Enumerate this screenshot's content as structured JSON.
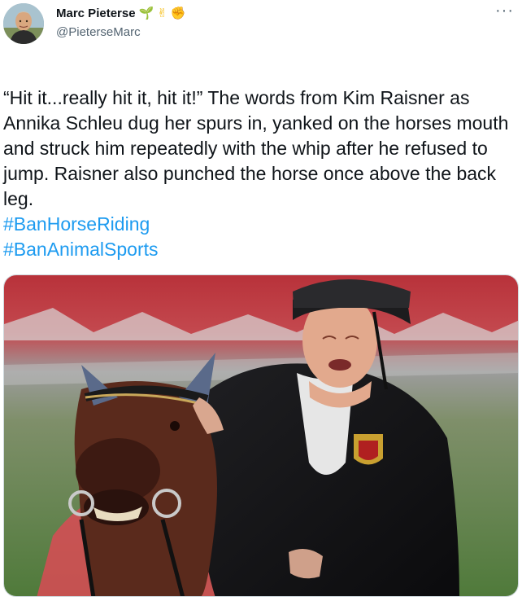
{
  "author": {
    "display_name": "Marc Pieterse",
    "emojis": [
      "🌱",
      "✌",
      "✊"
    ],
    "handle": "@PieterseMarc"
  },
  "more_label": "···",
  "tweet": {
    "text": "“Hit it...really hit it, hit it!” The words from Kim Raisner as Annika Schleu dug her spurs in, yanked on the horses mouth and struck him repeatedly with the whip after he refused to jump. Raisner also punched the horse once above the back leg.",
    "hashtags": [
      "#BanHorseRiding",
      "#BanAnimalSports"
    ]
  },
  "colors": {
    "link": "#1d9bf0",
    "text": "#0f1419",
    "muted": "#536471"
  },
  "icons": {
    "more": "more-dots-icon",
    "avatar": "profile-photo"
  }
}
